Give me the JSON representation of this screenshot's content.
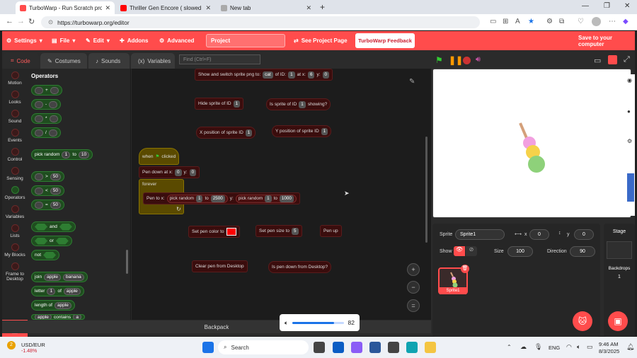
{
  "browser": {
    "tabs": [
      {
        "title": "TurboWarp - Run Scratch project",
        "color": "#ff4c4c"
      },
      {
        "title": "Thriller Gen Encore ( slowed ) - Yo",
        "color": "#ff0000"
      },
      {
        "title": "New tab",
        "color": "#888888"
      }
    ],
    "url": "https://turbowarp.org/editor"
  },
  "menu": {
    "settings": "Settings",
    "file": "File",
    "edit": "Edit",
    "addons": "Addons",
    "advanced": "Advanced",
    "project_title": "Project",
    "see_project_page": "See Project Page",
    "feedback": "TurboWarp Feedback",
    "save": "Save to your computer"
  },
  "editor_tabs": {
    "code": "Code",
    "costumes": "Costumes",
    "sounds": "Sounds",
    "variables": "Variables"
  },
  "find_placeholder": "Find (Ctrl+F)",
  "categories": [
    "Motion",
    "Looks",
    "Sound",
    "Events",
    "Control",
    "Sensing",
    "Operators",
    "Variables",
    "Lists",
    "My Blocks",
    "Frame to Desktop"
  ],
  "palette": {
    "header": "Operators",
    "plus": "+",
    "minus": "-",
    "times": "*",
    "divide": "/",
    "pick_random": "pick random",
    "to": "to",
    "r1": "1",
    "r2": "10",
    "gt": ">",
    "lt": "<",
    "eq": "=",
    "fifty": "50",
    "and": "and",
    "or": "or",
    "not": "not",
    "join": "join",
    "apple": "apple",
    "banana": "banana",
    "letter": "letter",
    "one": "1",
    "of": "of",
    "length_of": "length of",
    "contains": "contains",
    "a": "a"
  },
  "workspace": {
    "show_switch": "Show and switch sprite png to:",
    "cat": "cat",
    "of_id": "of ID:",
    "v1": "1",
    "at_x": "at x:",
    "v6": "6",
    "y": "y:",
    "v0": "0",
    "hide_sprite": "Hide sprite of ID",
    "is_sprite": "Is sprite of ID",
    "showing": "showing?",
    "x_pos": "X position of sprite ID",
    "y_pos": "Y position of sprite ID",
    "when": "when",
    "clicked": "clicked",
    "pen_down_at": "Pen down at x:",
    "y_colon": "y:",
    "forever": "forever",
    "pen_to_x": "Pen to x:",
    "pick_random": "pick random",
    "to": "to",
    "v2500": "2500",
    "v1000": "1000",
    "set_pen_color": "Set pen color to",
    "set_pen_size": "Set pen size to",
    "v5": "5",
    "pen_up": "Pen up",
    "clear_pen": "Clear pen from Desktop",
    "is_pen_down": "Is pen down from Desktop?"
  },
  "backpack": "Backpack",
  "volume": {
    "value": "82",
    "level": 0.82
  },
  "sprite": {
    "label": "Sprite",
    "name": "Sprite1",
    "x_label": "x",
    "x": "0",
    "y_label": "y",
    "y": "0",
    "show_label": "Show",
    "size_label": "Size",
    "size": "100",
    "direction_label": "Direction",
    "direction": "90",
    "thumb_name": "Sprite1"
  },
  "stage_panel": {
    "title": "Stage",
    "backdrops": "Backdrops",
    "count": "1"
  },
  "taskbar": {
    "ticker": "USD/EUR",
    "change": "-1.48%",
    "badge": "2",
    "search": "Search",
    "lang": "ENG",
    "time": "9:46 AM",
    "date": "8/3/2025"
  },
  "colors": {
    "accent": "#ff4c4c",
    "operators": "#2e7d32",
    "pen_color": "#ff0000"
  }
}
